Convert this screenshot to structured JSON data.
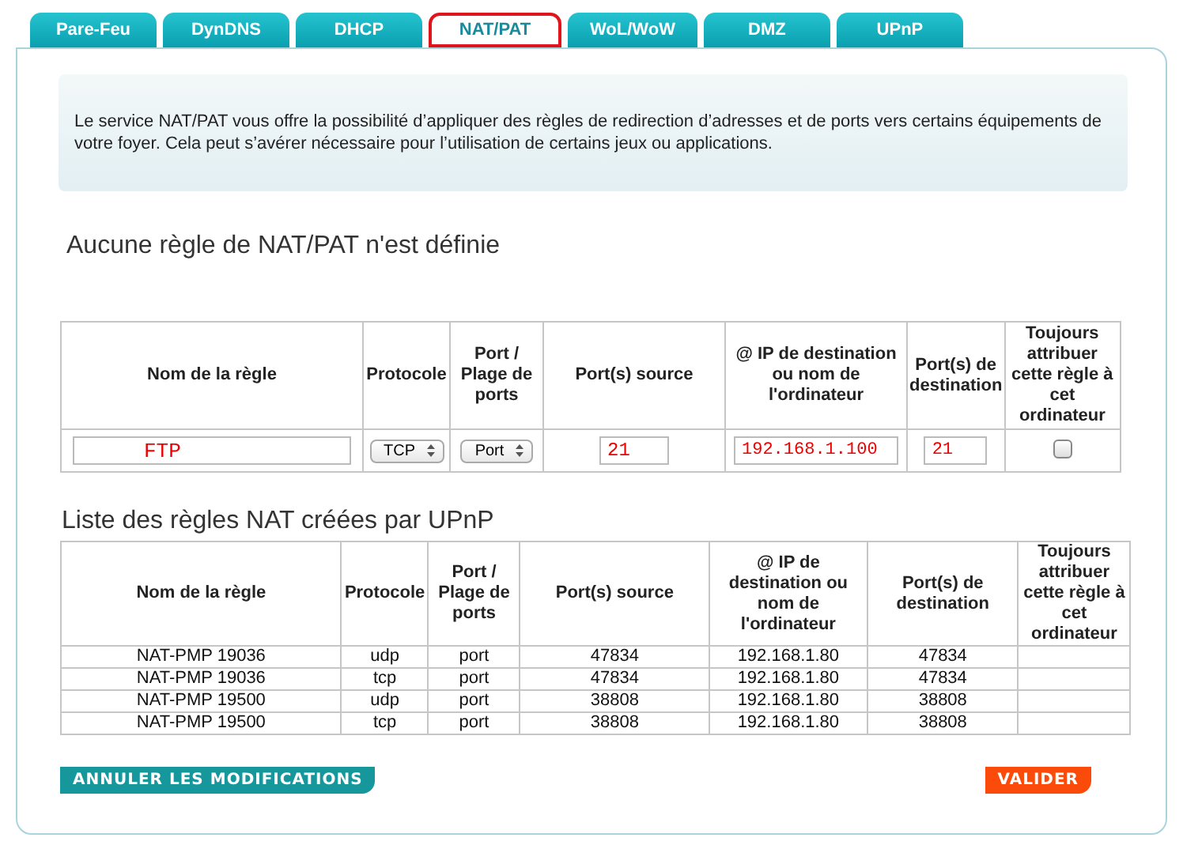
{
  "tabs": [
    {
      "label": "Pare-Feu",
      "selected": false
    },
    {
      "label": "DynDNS",
      "selected": false
    },
    {
      "label": "DHCP",
      "selected": false
    },
    {
      "label": "NAT/PAT",
      "selected": true
    },
    {
      "label": "WoL/WoW",
      "selected": false
    },
    {
      "label": "DMZ",
      "selected": false
    },
    {
      "label": "UPnP",
      "selected": false
    }
  ],
  "intro": "Le service NAT/PAT vous offre la possibilité d’appliquer des règles de redirection d’adresses et de ports vers certains équipements de votre foyer. Cela peut s’avérer nécessaire pour l’utilisation de certains jeux ou applications.",
  "rules_heading": "Aucune règle de NAT/PAT n'est définie",
  "rule_form": {
    "columns": [
      "Nom de la règle",
      "Protocole",
      "Port / Plage de ports",
      "Port(s) source",
      "@ IP de destination ou nom de l'ordinateur",
      "Port(s) de destination",
      "Toujours attribuer cette règle à cet ordinateur"
    ],
    "fields": [
      {
        "kind": "text",
        "value": "FTP"
      },
      {
        "kind": "select",
        "value": "TCP"
      },
      {
        "kind": "select",
        "value": "Port"
      },
      {
        "kind": "text",
        "value": "21"
      },
      {
        "kind": "text",
        "value": "192.168.1.100"
      },
      {
        "kind": "text",
        "value": "21"
      },
      {
        "kind": "checkbox",
        "checked": false
      }
    ]
  },
  "upnp_heading": "Liste des règles NAT créées par UPnP",
  "upnp_table": {
    "columns": [
      "Nom de la règle",
      "Protocole",
      "Port / Plage de ports",
      "Port(s) source",
      "@ IP de destination ou nom de l'ordinateur",
      "Port(s) de destination",
      "Toujours attribuer cette règle à cet ordinateur"
    ],
    "rows": [
      [
        "NAT-PMP 19036",
        "udp",
        "port",
        "47834",
        "192.168.1.80",
        "47834"
      ],
      [
        "NAT-PMP 19036",
        "tcp",
        "port",
        "47834",
        "192.168.1.80",
        "47834"
      ],
      [
        "NAT-PMP 19500",
        "udp",
        "port",
        "38808",
        "192.168.1.80",
        "38808"
      ],
      [
        "NAT-PMP 19500",
        "tcp",
        "port",
        "38808",
        "192.168.1.80",
        "38808"
      ]
    ]
  },
  "buttons": {
    "cancel": "ANNULER LES MODIFICATIONS",
    "submit": "VALIDER"
  }
}
